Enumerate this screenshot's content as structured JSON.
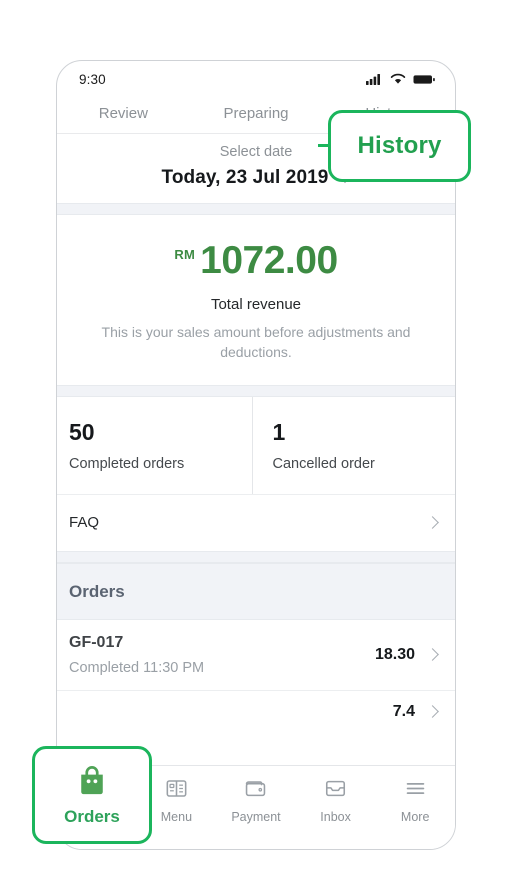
{
  "status_bar": {
    "time": "9:30",
    "icons": [
      "signal-icon",
      "wifi-icon",
      "battery-icon"
    ]
  },
  "tabs": [
    {
      "label": "Review",
      "active": false
    },
    {
      "label": "Preparing",
      "active": false
    },
    {
      "label": "History",
      "active": true
    }
  ],
  "date_selector": {
    "label": "Select date",
    "value": "Today, 23 Jul 2019",
    "chevron": "chevron-down-icon"
  },
  "revenue": {
    "currency": "RM",
    "amount": "1072.00",
    "label": "Total revenue",
    "description": "This is your sales amount before adjustments and deductions.",
    "color": "#3d8b43"
  },
  "stats": [
    {
      "value": "50",
      "label": "Completed orders"
    },
    {
      "value": "1",
      "label": "Cancelled order"
    }
  ],
  "faq": {
    "label": "FAQ",
    "chevron": "chevron-right-icon"
  },
  "orders_section": {
    "header": "Orders",
    "rows": [
      {
        "id": "GF-017",
        "status": "Completed 11:30 PM",
        "amount": "18.30",
        "chevron": "chevron-right-icon"
      },
      {
        "id": "",
        "status": "",
        "amount": "7.4",
        "chevron": "chevron-right-icon"
      }
    ]
  },
  "bottom_nav": [
    {
      "label": "Orders",
      "icon": "shopping-bag-icon",
      "active": true
    },
    {
      "label": "Menu",
      "icon": "menu-book-icon",
      "active": false
    },
    {
      "label": "Payment",
      "icon": "wallet-icon",
      "active": false
    },
    {
      "label": "Inbox",
      "icon": "inbox-tray-icon",
      "active": false
    },
    {
      "label": "More",
      "icon": "hamburger-icon",
      "active": false
    }
  ],
  "callouts": {
    "history": "History",
    "orders": "Orders",
    "border_color": "#1bb55c"
  }
}
